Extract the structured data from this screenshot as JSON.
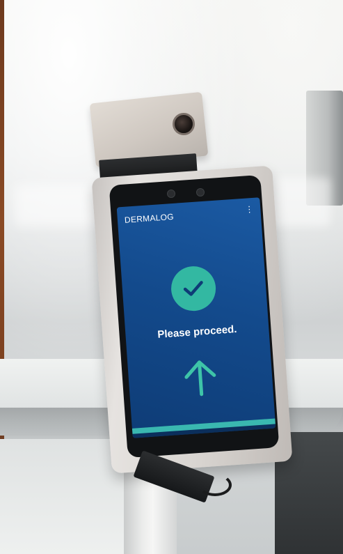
{
  "screen": {
    "brand": "DERMALOG",
    "menu_icon": "kebab-menu-icon",
    "status_icon": "check-icon",
    "message": "Please proceed.",
    "direction_icon": "arrow-up-icon",
    "progress": 1.0
  },
  "colors": {
    "screen_top": "#1b5aa3",
    "screen_bottom": "#0e3c76",
    "check_circle": "#33b8a2",
    "arrow": "#3ec4a8",
    "progress": "#3ab8b0"
  }
}
